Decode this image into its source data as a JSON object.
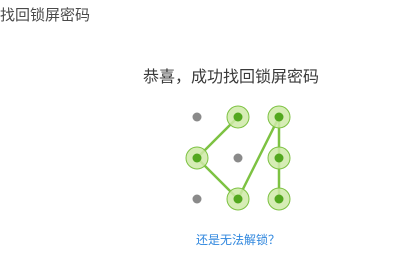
{
  "header": {
    "title": "找回锁屏密码"
  },
  "main": {
    "message": "恭喜，成功找回锁屏密码",
    "help_link": "还是无法解锁？"
  },
  "pattern": {
    "grid_size": 3,
    "sequence": [
      2,
      4,
      8,
      3,
      6,
      9
    ],
    "colors": {
      "line": "#7dc242",
      "node_ring": "#cfeaa8",
      "node_center": "#52a81e",
      "inactive_dot": "#8a8a8a"
    }
  }
}
